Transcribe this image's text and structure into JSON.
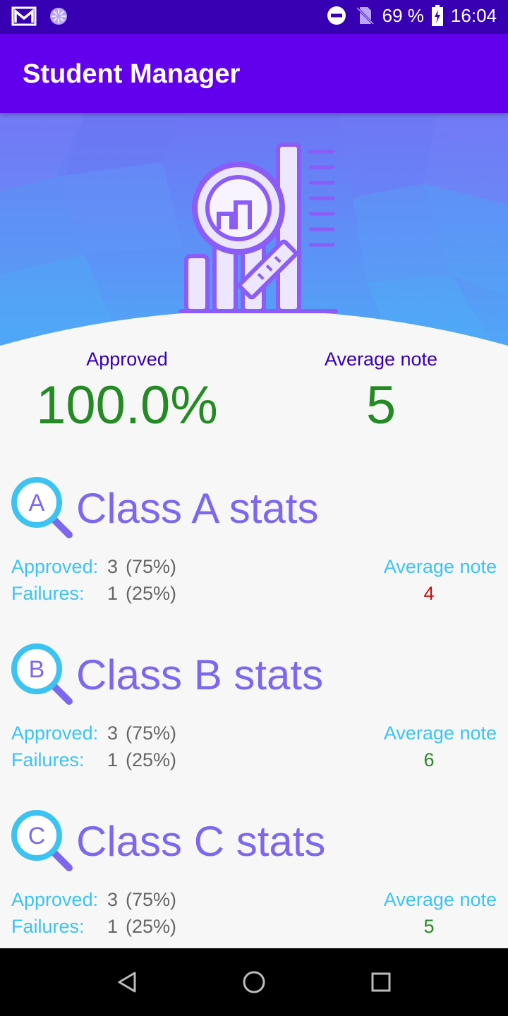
{
  "status_bar": {
    "battery": "69 %",
    "time": "16:04",
    "icons": [
      "gmail-icon",
      "loading-icon",
      "do-not-disturb-icon",
      "no-sim-icon",
      "battery-charging-icon"
    ]
  },
  "app_bar": {
    "title": "Student Manager"
  },
  "summary": {
    "approved_label": "Approved",
    "approved_value": "100.0%",
    "average_label": "Average note",
    "average_value": "5"
  },
  "classes": [
    {
      "letter": "A",
      "title": "Class A stats",
      "approved_label": "Approved:",
      "approved_count": "3",
      "approved_pct": "(75%)",
      "failures_label": "Failures:",
      "failures_count": "1",
      "failures_pct": "(25%)",
      "average_label": "Average note",
      "average_value": "4",
      "average_color": "#cc1111"
    },
    {
      "letter": "B",
      "title": "Class B stats",
      "approved_label": "Approved:",
      "approved_count": "3",
      "approved_pct": "(75%)",
      "failures_label": "Failures:",
      "failures_count": "1",
      "failures_pct": "(25%)",
      "average_label": "Average note",
      "average_value": "6",
      "average_color": "#248a24"
    },
    {
      "letter": "C",
      "title": "Class C stats",
      "approved_label": "Approved:",
      "approved_count": "3",
      "approved_pct": "(75%)",
      "failures_label": "Failures:",
      "failures_count": "1",
      "failures_pct": "(25%)",
      "average_label": "Average note",
      "average_value": "5",
      "average_color": "#248a24"
    }
  ],
  "colors": {
    "status_bar": "#3700b3",
    "app_bar": "#6200ee",
    "accent_purple": "#7b68ee",
    "label_cyan": "#3cc3f2",
    "success_green": "#248a24",
    "fail_red": "#cc1111"
  },
  "nav_bar": {
    "icons": [
      "back-icon",
      "home-icon",
      "recents-icon"
    ]
  }
}
